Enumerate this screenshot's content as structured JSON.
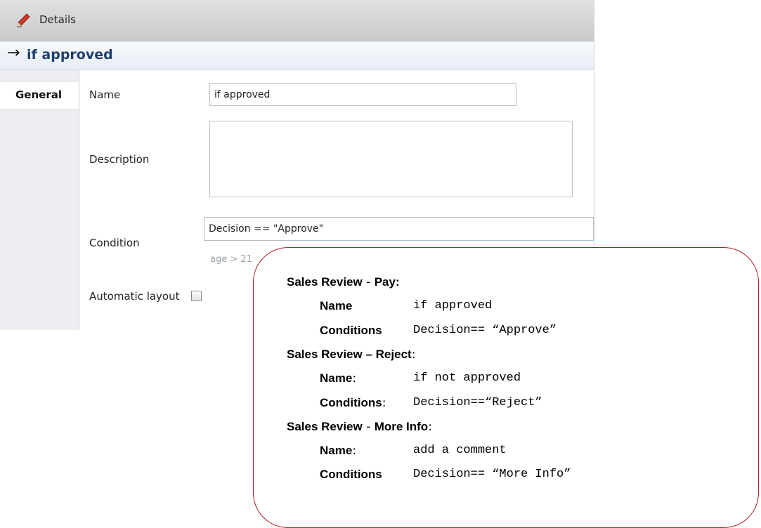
{
  "titlebar": {
    "title": "Details"
  },
  "header": {
    "arrow": "→",
    "title": "if approved"
  },
  "tabs": {
    "general": "General"
  },
  "form": {
    "name_label": "Name",
    "name_value": "if approved",
    "description_label": "Description",
    "description_value": "",
    "condition_label": "Condition",
    "condition_value": "Decision == \"Approve\"",
    "condition_hint": "age > 21",
    "automatic_layout_label": "Automatic layout",
    "automatic_layout_checked": false
  },
  "callout": {
    "transitions": [
      {
        "prefix": "Sales Review",
        "sep": " - ",
        "target": "Pay:",
        "after": "",
        "name_label": "Name",
        "name_suffix": "",
        "name_value": "if approved",
        "cond_label": "Conditions",
        "cond_suffix": "",
        "cond_value": "Decision== “Approve”"
      },
      {
        "prefix": "Sales Review",
        "sep": " – ",
        "target": "Reject",
        "after": ":",
        "name_label": "Name",
        "name_suffix": ":",
        "name_value": "if not approved",
        "cond_label": "Conditions",
        "cond_suffix": ":",
        "cond_value": "Decision==“Reject”"
      },
      {
        "prefix": "Sales Review",
        "sep": " - ",
        "target": "More Info",
        "after": ":",
        "name_label": "Name",
        "name_suffix": ":",
        "name_value": "add a comment",
        "cond_label": "Conditions",
        "cond_suffix": "",
        "cond_value": "Decision== “More Info”"
      }
    ]
  },
  "colors": {
    "accent_header_text": "#1f3f6e",
    "callout_border": "#b21f24"
  }
}
